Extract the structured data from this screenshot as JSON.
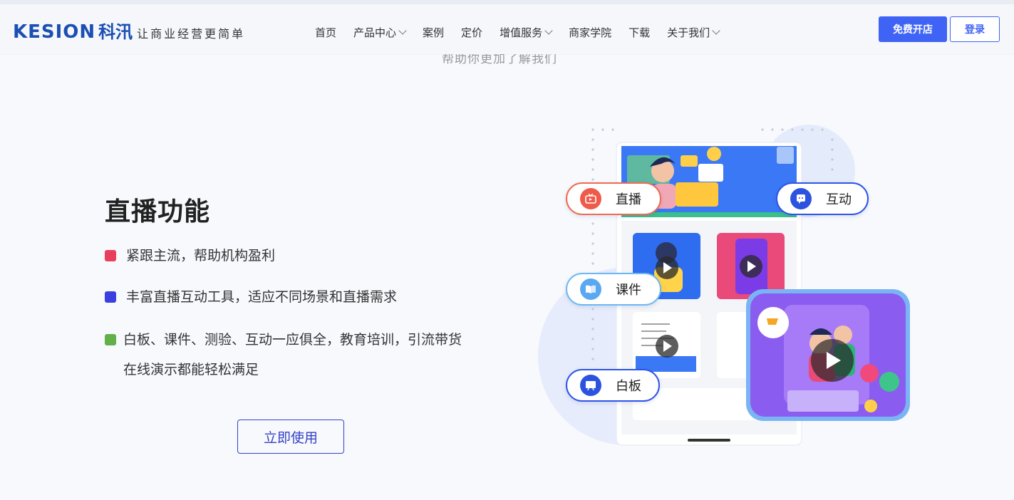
{
  "header": {
    "logo_en": "KESION",
    "logo_cn": "科汛",
    "logo_slogan": "让商业经营更简单",
    "nav": [
      {
        "label": "首页",
        "dropdown": false
      },
      {
        "label": "产品中心",
        "dropdown": true
      },
      {
        "label": "案例",
        "dropdown": false
      },
      {
        "label": "定价",
        "dropdown": false
      },
      {
        "label": "增值服务",
        "dropdown": true
      },
      {
        "label": "商家学院",
        "dropdown": false
      },
      {
        "label": "下载",
        "dropdown": false
      },
      {
        "label": "关于我们",
        "dropdown": true
      }
    ],
    "free_button": "免费开店",
    "login_button": "登录"
  },
  "ghost_text": "帮助你更加了解我们",
  "main": {
    "title": "直播功能",
    "features": [
      {
        "text": "紧跟主流，帮助机构盈利",
        "color": "#e8405a"
      },
      {
        "text": "丰富直播互动工具，适应不同场景和直播需求",
        "color": "#3c3fe0"
      },
      {
        "text": "白板、课件、测验、互动一应俱全，教育培训，引流带货",
        "text2": "在线演示都能轻松满足",
        "color": "#62b04a"
      }
    ],
    "use_button": "立即使用"
  },
  "illustration": {
    "pills": [
      {
        "label": "直播",
        "icon": "tv-icon"
      },
      {
        "label": "互动",
        "icon": "chat-icon"
      },
      {
        "label": "课件",
        "icon": "book-icon"
      },
      {
        "label": "白板",
        "icon": "whiteboard-icon"
      }
    ]
  },
  "colors": {
    "accent": "#3f63f5",
    "brand": "#1b4fb3"
  }
}
